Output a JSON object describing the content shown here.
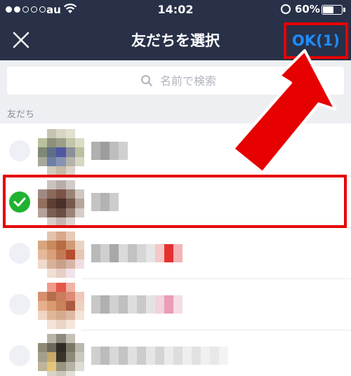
{
  "status_bar": {
    "carrier": "au",
    "time": "14:02",
    "battery_percent": "60%",
    "battery_level": 0.6
  },
  "nav": {
    "title": "友だちを選択",
    "ok_label": "OK(1)"
  },
  "search": {
    "placeholder": "名前で検索"
  },
  "section": {
    "title": "友だち"
  },
  "friends": [
    {
      "selected": false
    },
    {
      "selected": true
    },
    {
      "selected": false
    },
    {
      "selected": false
    },
    {
      "selected": false
    }
  ],
  "colors": {
    "header_bg": "#283148",
    "ok_blue": "#1e8cff",
    "check_green": "#1fb230",
    "annotation_red": "#e60000"
  }
}
